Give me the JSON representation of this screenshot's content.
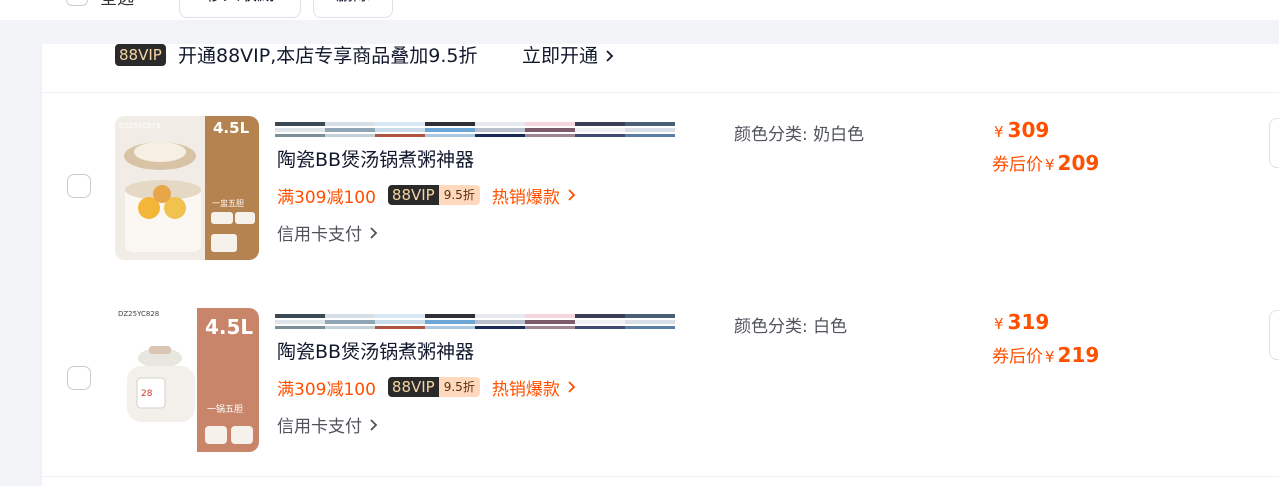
{
  "toolbar": {
    "select_all_label": "全选",
    "move_to_favorites_label": "移入收藏",
    "delete_label": "删除"
  },
  "vip_banner": {
    "badge": "88VIP",
    "text": "开通88VIP,本店专享商品叠加9.5折",
    "link": "立即开通"
  },
  "items": [
    {
      "thumb_volume": "4.5L",
      "thumb_model": "DZ25FC873",
      "thumb_feature": "一盅五胆",
      "title": "陶瓷BB煲汤锅煮粥神器",
      "promo_discount": "满309减100",
      "promo_vip_badge": "88VIP",
      "promo_vip_discount": "9.5折",
      "promo_hot": "热销爆款",
      "payment": "信用卡支付",
      "sku_label": "颜色分类:",
      "sku_value": "奶白色",
      "currency": "¥",
      "price": "309",
      "coupon_label": "券后价",
      "coupon_price": "209"
    },
    {
      "thumb_volume": "4.5L",
      "thumb_model": "DZ25YC828",
      "thumb_feature": "一锅五胆",
      "title": "陶瓷BB煲汤锅煮粥神器",
      "promo_discount": "满309减100",
      "promo_vip_badge": "88VIP",
      "promo_vip_discount": "9.5折",
      "promo_hot": "热销爆款",
      "payment": "信用卡支付",
      "sku_label": "颜色分类:",
      "sku_value": "白色",
      "currency": "¥",
      "price": "319",
      "coupon_label": "券后价",
      "coupon_price": "219"
    }
  ],
  "colors": {
    "accent": "#ff5000",
    "text_primary": "#11192d",
    "text_secondary": "#50535c",
    "vip_dark": "#2a2a2a",
    "vip_gold": "#f4d5a5",
    "vip_discount_bg": "#ffd9bd"
  }
}
